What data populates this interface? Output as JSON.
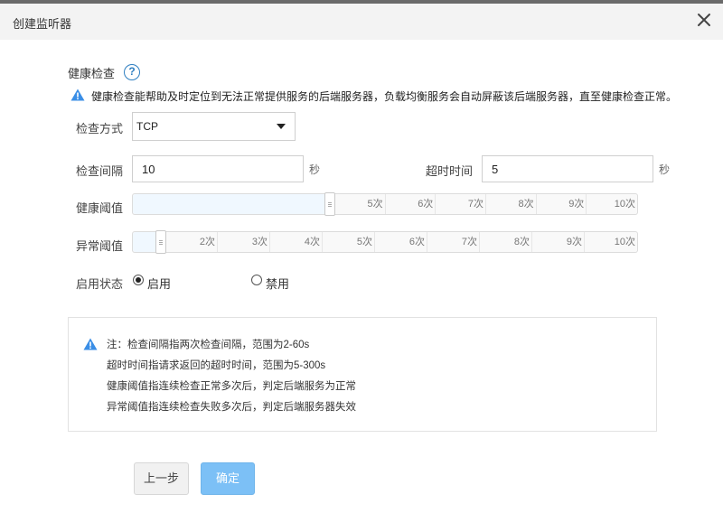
{
  "dialog": {
    "title": "创建监听器"
  },
  "health_check": {
    "section_title": "健康检查",
    "help_symbol": "?",
    "warning_text": "健康检查能帮助及时定位到无法正常提供服务的后端服务器，负载均衡服务会自动屏蔽该后端服务器，直至健康检查正常。",
    "method": {
      "label": "检查方式",
      "value": "TCP"
    },
    "interval": {
      "label": "检查间隔",
      "value": "10",
      "unit": "秒"
    },
    "timeout": {
      "label": "超时时间",
      "value": "5",
      "unit": "秒"
    },
    "healthy_threshold": {
      "label": "健康阈值",
      "value": 5,
      "ticks": [
        "5次",
        "6次",
        "7次",
        "8次",
        "9次",
        "10次"
      ]
    },
    "unhealthy_threshold": {
      "label": "异常阈值",
      "value": 2,
      "ticks": [
        "2次",
        "3次",
        "4次",
        "5次",
        "6次",
        "7次",
        "8次",
        "9次",
        "10次"
      ]
    },
    "status": {
      "label": "启用状态",
      "enabled_label": "启用",
      "disabled_label": "禁用",
      "selected": "enabled"
    }
  },
  "notes": {
    "lines": [
      "注：检查间隔指两次检查间隔，范围为2-60s",
      "超时时间指请求返回的超时时间，范围为5-300s",
      "健康阈值指连续检查正常多次后，判定后端服务为正常",
      "异常阈值指连续检查失败多次后，判定后端服务器失效"
    ]
  },
  "buttons": {
    "prev_label": "上一步",
    "ok_label": "确定"
  },
  "colors": {
    "primary_button": "#7cc0f6",
    "warning_icon": "#3a8ee6",
    "help_icon": "#2f7fc1"
  }
}
